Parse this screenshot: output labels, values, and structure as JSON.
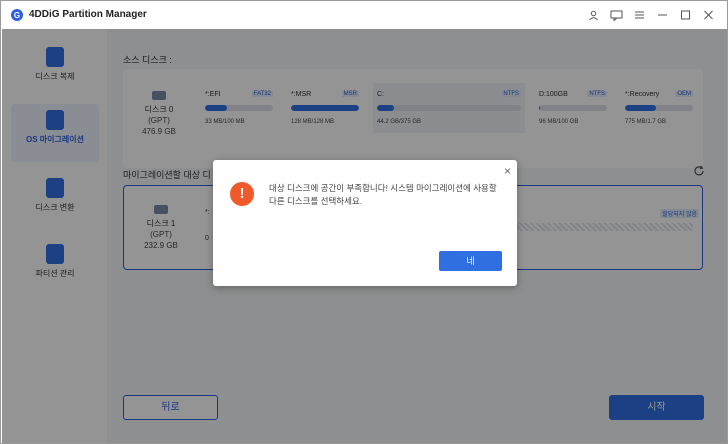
{
  "app": {
    "title": "4DDiG Partition Manager",
    "logo_glyph": "G"
  },
  "titlebar_icons": [
    "user-icon",
    "feedback-icon",
    "menu-icon",
    "minimize-icon",
    "maximize-icon",
    "close-icon"
  ],
  "sidebar": {
    "items": [
      {
        "label": "디스크 복제",
        "icon": "disk-clone-icon",
        "active": false
      },
      {
        "label": "OS 마이그레이션",
        "icon": "os-migration-icon",
        "active": true
      },
      {
        "label": "디스크 변환",
        "icon": "disk-convert-icon",
        "active": false
      },
      {
        "label": "파티션 관리",
        "icon": "partition-manage-icon",
        "active": false
      }
    ]
  },
  "source": {
    "title": "소스 디스크 :",
    "disk": {
      "name": "디스크 0",
      "scheme": "(GPT)",
      "size": "476.9 GB"
    },
    "partitions": [
      {
        "name": "*:EFI",
        "type": "FAT32",
        "size": "33 MB/100 MB",
        "used": 0.33
      },
      {
        "name": "*:MSR",
        "type": "MSR",
        "size": "128 MB/128 MB",
        "used": 1.0
      },
      {
        "name": "C:",
        "type": "NTFS",
        "size": "44.2 GB/375 GB",
        "used": 0.12
      },
      {
        "name": "D:100GB",
        "type": "NTFS",
        "size": "96 MB/100 GB",
        "used": 0.01
      },
      {
        "name": "*:Recovery",
        "type": "OEM",
        "size": "775 MB/1.7 GB",
        "used": 0.45
      }
    ]
  },
  "target": {
    "title": "마이그레이션할 대상 디",
    "disk": {
      "name": "디스크 1",
      "scheme": "(GPT)",
      "size": "232.9 GB"
    },
    "partition_prefix": "*:",
    "partition_size_prefix": "0",
    "unallocated_label": "할당되지 않음"
  },
  "buttons": {
    "back": "뒤로",
    "start": "시작"
  },
  "dialog": {
    "message": "대상 디스크에 공간이 부족합니다! 시스템 마이그레이션에 사용할 다른 디스크를 선택하세요.",
    "ok": "네",
    "warn_glyph": "!",
    "close_glyph": "×"
  },
  "colors": {
    "accent": "#2f6fe2",
    "warning": "#f05a2a"
  }
}
